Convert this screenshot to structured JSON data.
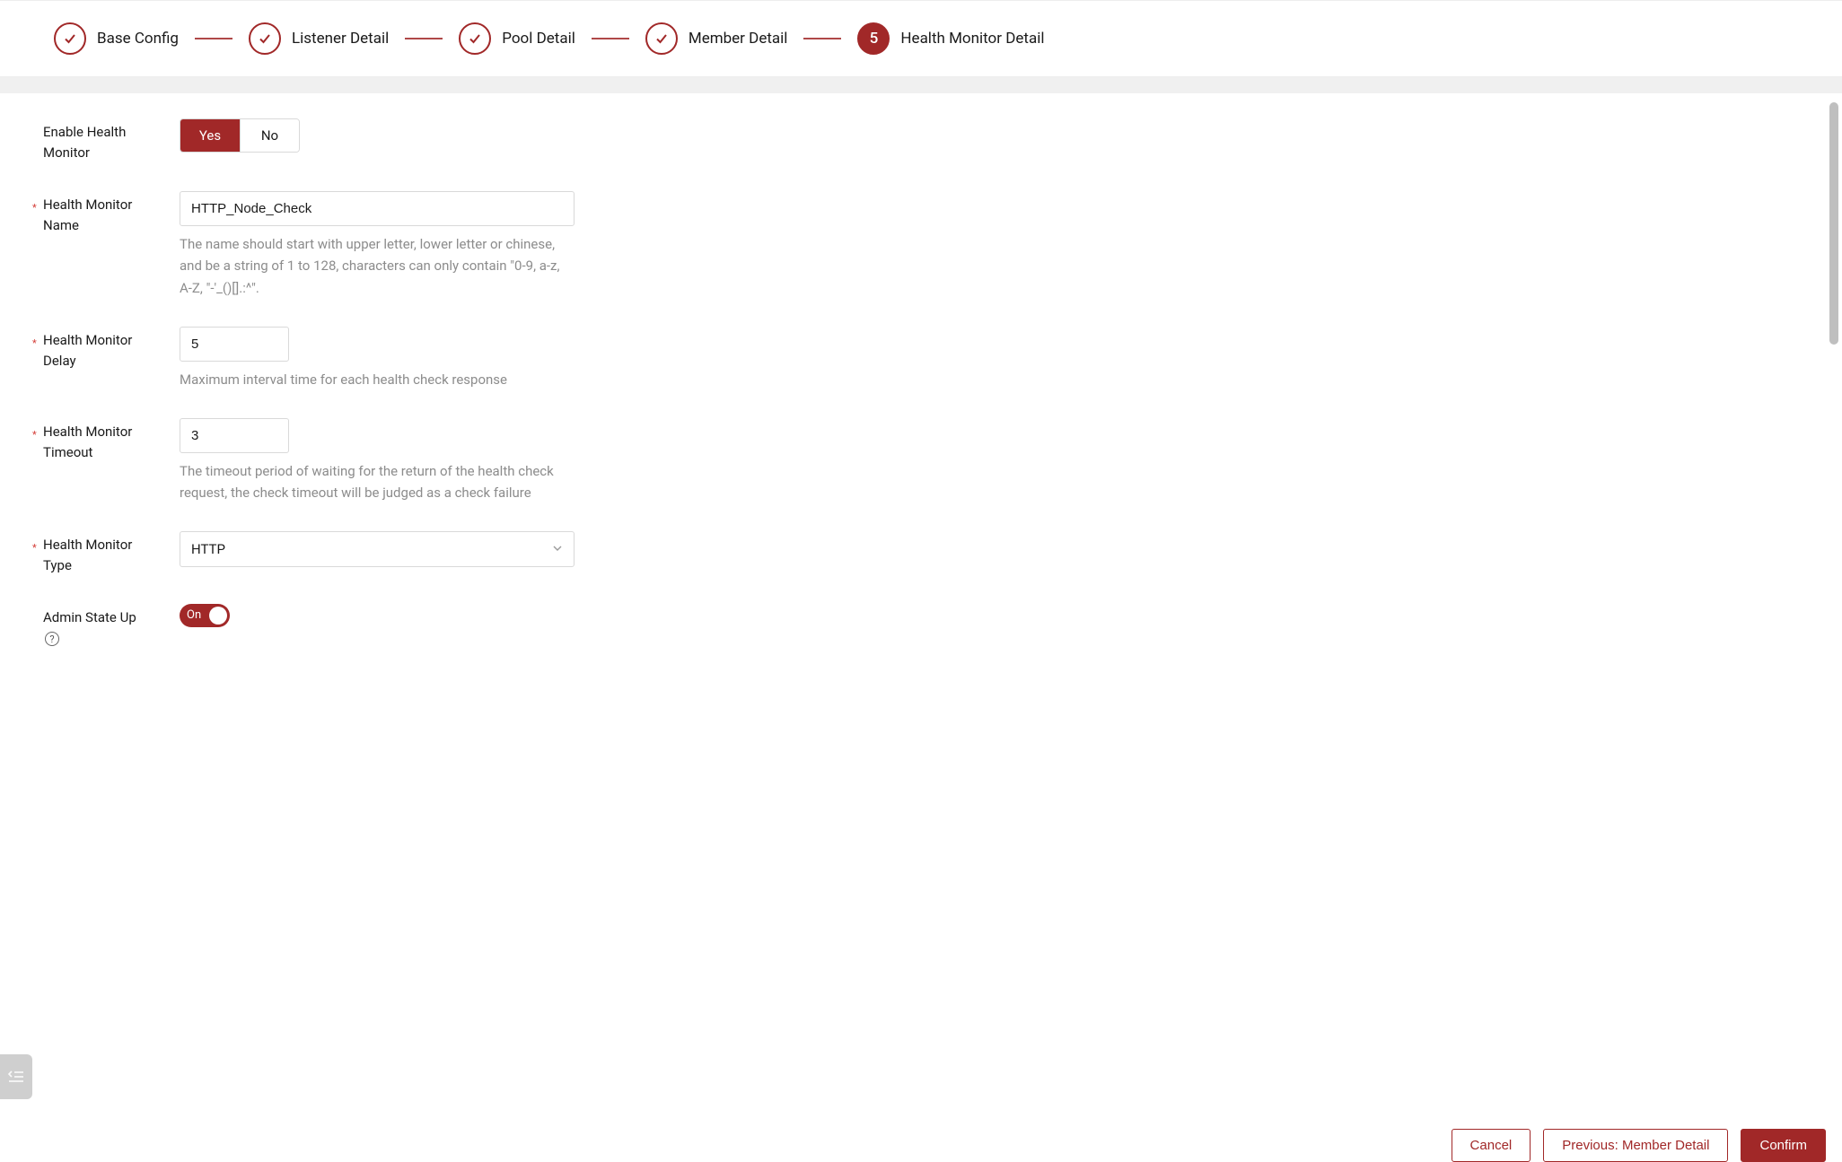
{
  "stepper": {
    "steps": [
      {
        "label": "Base Config",
        "state": "done"
      },
      {
        "label": "Listener Detail",
        "state": "done"
      },
      {
        "label": "Pool Detail",
        "state": "done"
      },
      {
        "label": "Member Detail",
        "state": "done"
      },
      {
        "label": "Health Monitor Detail",
        "state": "current",
        "number": "5"
      }
    ]
  },
  "form": {
    "enable": {
      "label": "Enable Health Monitor",
      "option_yes": "Yes",
      "option_no": "No",
      "value": "Yes"
    },
    "name": {
      "label": "Health Monitor Name",
      "value": "HTTP_Node_Check",
      "hint": "The name should start with upper letter, lower letter or chinese, and be a string of 1 to 128, characters can only contain \"0-9, a-z, A-Z, \"-'_()[].:^\"."
    },
    "delay": {
      "label": "Health Monitor Delay",
      "value": "5",
      "hint": "Maximum interval time for each health check response"
    },
    "timeout": {
      "label": "Health Monitor Timeout",
      "value": "3",
      "hint": "The timeout period of waiting for the return of the health check request, the check timeout will be judged as a check failure"
    },
    "type": {
      "label": "Health Monitor Type",
      "value": "HTTP"
    },
    "admin_state": {
      "label": "Admin State Up",
      "switch_label": "On",
      "value": true
    }
  },
  "footer": {
    "cancel": "Cancel",
    "previous": "Previous: Member Detail",
    "confirm": "Confirm"
  },
  "colors": {
    "accent": "#a12828"
  }
}
